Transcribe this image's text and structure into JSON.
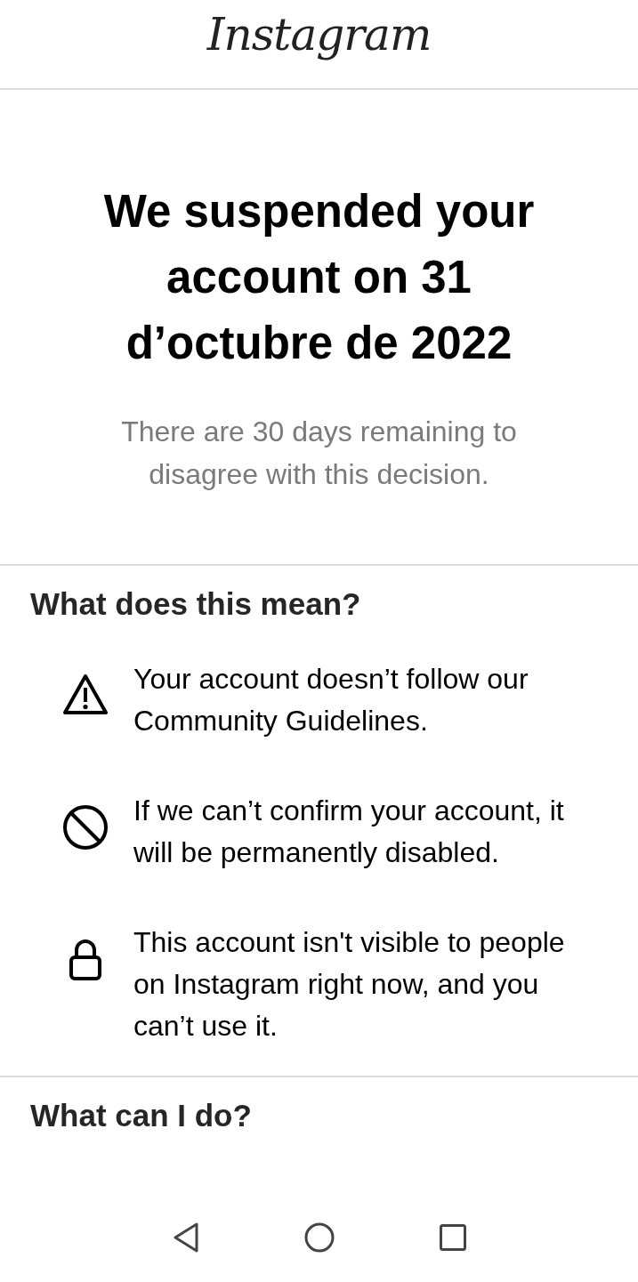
{
  "header": {
    "logo": "Instagram"
  },
  "notice": {
    "title": "We suspended your account on 31 d’octubre de 2022",
    "subtitle": "There are 30 days remaining to disagree with this decision."
  },
  "sections": [
    {
      "heading": "What does this mean?",
      "items": [
        {
          "kind": "warning",
          "text": "Your account doesn’t follow our Community Guidelines."
        },
        {
          "kind": "blocked",
          "text": "If we can’t confirm your account, it will be permanently disabled."
        },
        {
          "kind": "lock",
          "text": "This account isn't visible to people on Instagram right now, and you can’t use it."
        }
      ]
    },
    {
      "heading": "What can I do?"
    }
  ]
}
